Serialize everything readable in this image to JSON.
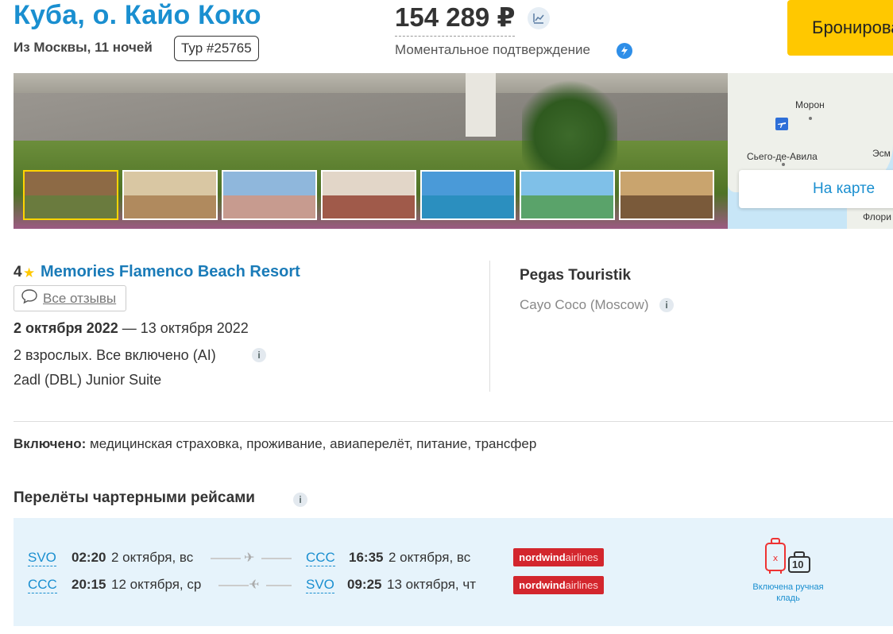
{
  "header": {
    "title": "Куба, о. Кайо Коко",
    "subtitle": "Из Москвы, 11 ночей",
    "tour_number": "Тур #25765",
    "price": "154 289 ₽",
    "instant_confirmation": "Моментальное подтверждение",
    "book_label": "Бронировать"
  },
  "map": {
    "labels": [
      "Морон",
      "Сьего-де-Авила",
      "Эсм",
      "Флори"
    ],
    "button_label": "На карте"
  },
  "hotel": {
    "stars": "4",
    "name": "Memories Flamenco Beach Resort",
    "reviews_label": "Все отзывы",
    "date_from": "2 октября 2022",
    "date_to": "— 13 октября 2022",
    "guests": "2 взрослых. Все включено (AI)",
    "room": "2adl (DBL) Junior Suite"
  },
  "operator": {
    "name": "Pegas Touristik",
    "origin": "Cayo Coco (Moscow)"
  },
  "included": {
    "label": "Включено:",
    "items": "медицинская страховка, проживание, авиаперелёт, питание, трансфер"
  },
  "flights": {
    "title": "Перелёты чартерными рейсами",
    "rows": [
      {
        "from": "SVO",
        "dep_time": "02:20",
        "dep_date": "2 октября, вс",
        "to": "CCC",
        "arr_time": "16:35",
        "arr_date": "2 октября, вс",
        "airline": "nordwind",
        "airline_suffix": "airlines"
      },
      {
        "from": "CCC",
        "dep_time": "20:15",
        "dep_date": "12 октября, ср",
        "to": "SVO",
        "arr_time": "09:25",
        "arr_date": "13 октября, чт",
        "airline": "nordwind",
        "airline_suffix": "airlines"
      }
    ],
    "baggage_caption": "Включена ручная кладь",
    "hand_luggage_kg": "10"
  },
  "colors": {
    "accent": "#1a8fd0",
    "book_button": "#ffc800",
    "airline": "#d3262d",
    "flights_bg": "#e6f3fb"
  }
}
